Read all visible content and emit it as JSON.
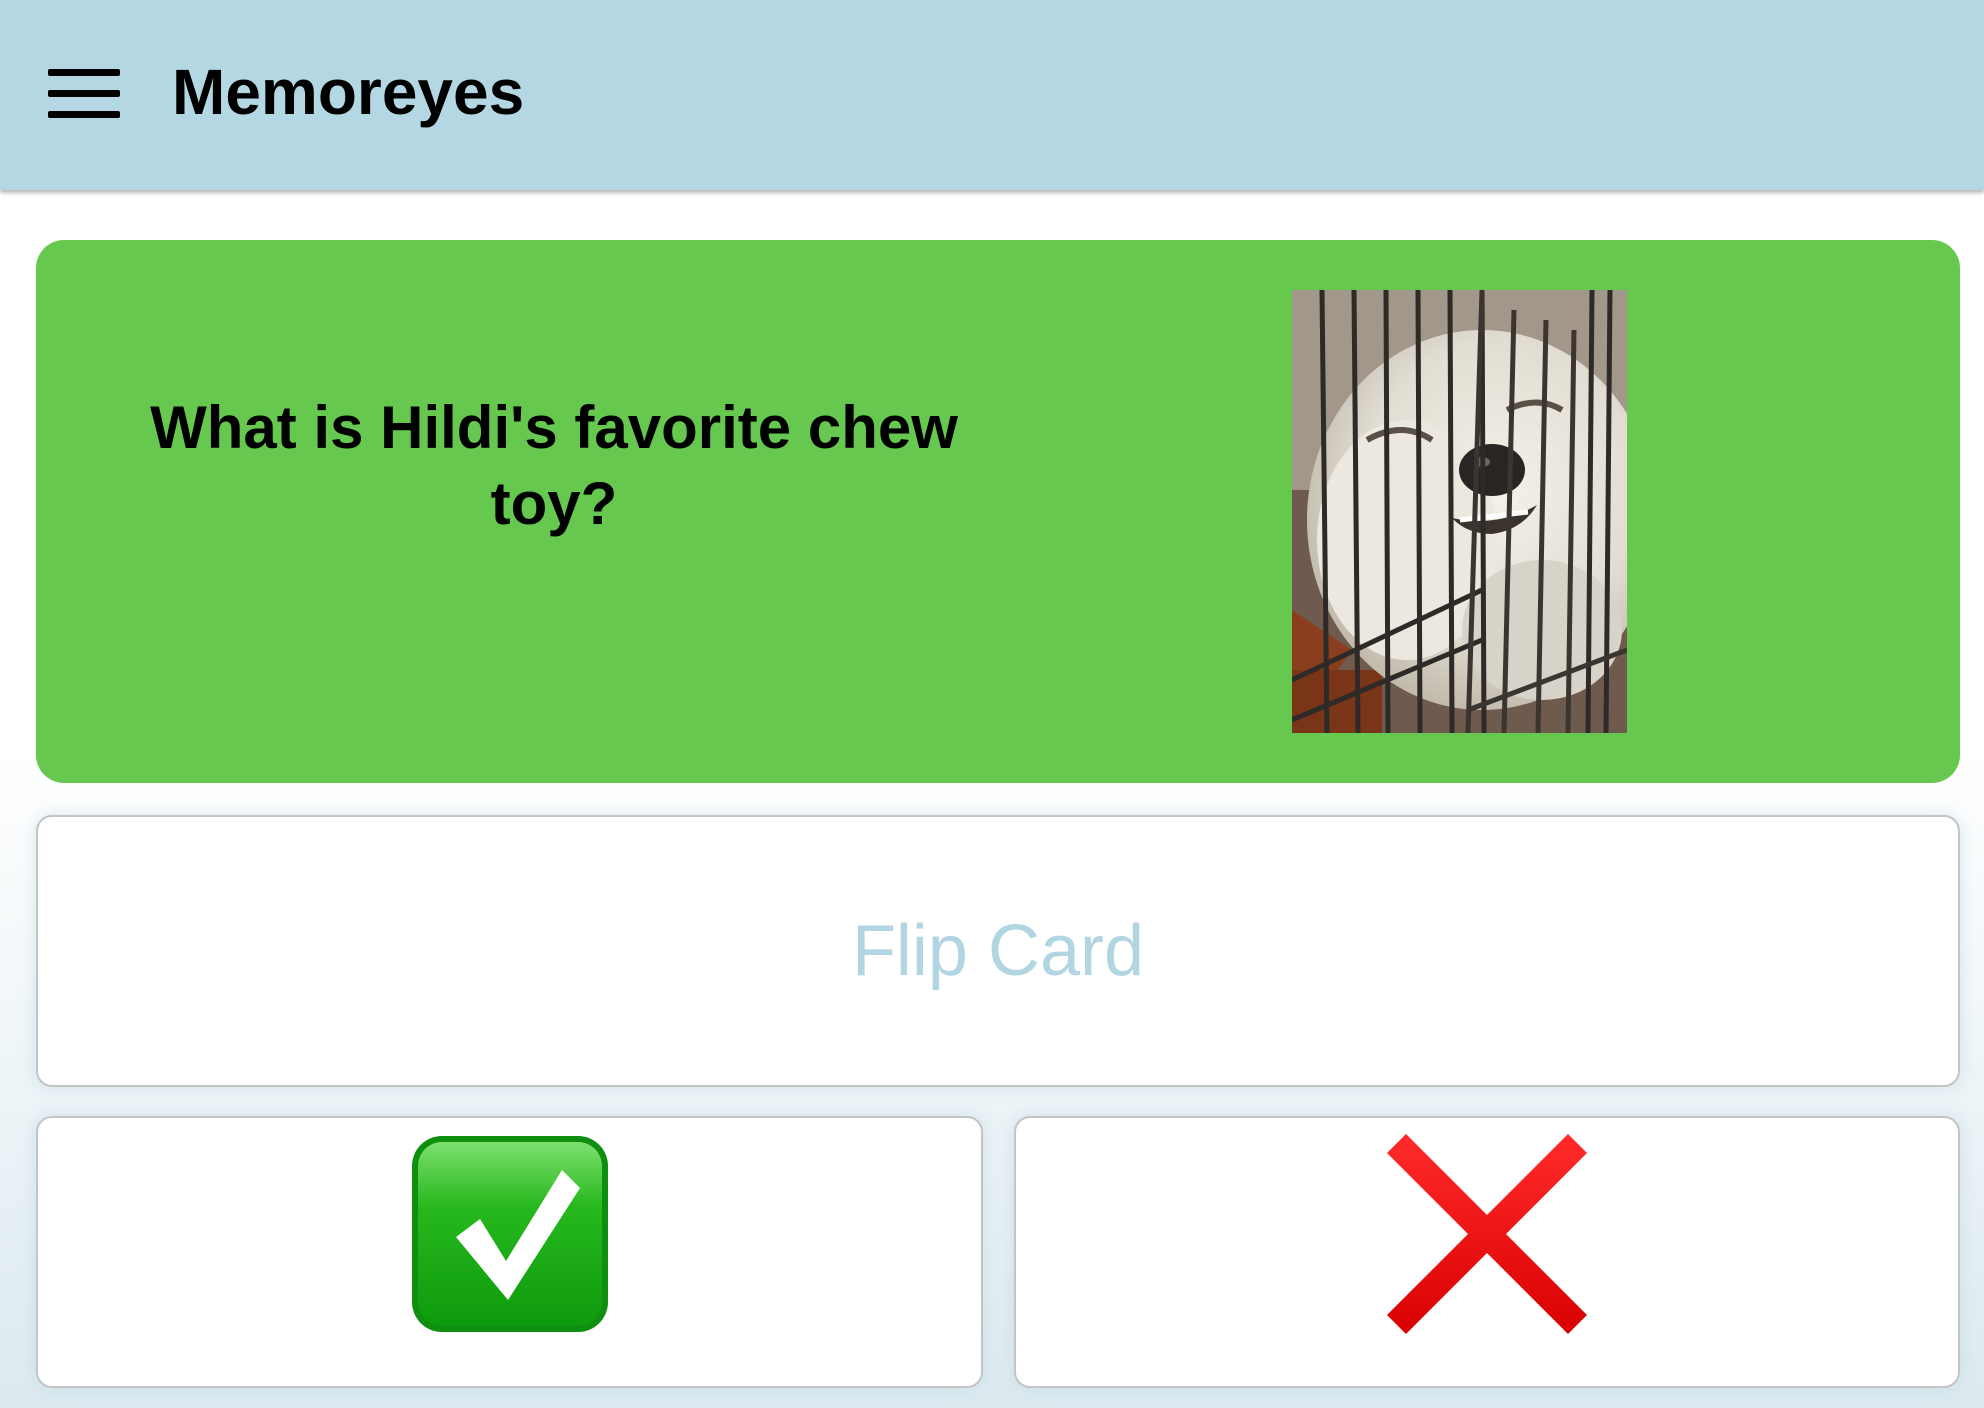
{
  "app": {
    "title": "Memoreyes",
    "menu_icon": "hamburger-menu-icon"
  },
  "card": {
    "question": "What is Hildi's favorite chew toy?",
    "background_color": "#66c84f",
    "image": {
      "subject": "white dog pressing face against wire crate bars"
    }
  },
  "actions": {
    "flip_label": "Flip Card",
    "correct_icon": "check-mark-icon",
    "incorrect_icon": "cross-mark-icon"
  },
  "colors": {
    "app_bar": "#b4d8e3",
    "flip_text": "#b1d5e1",
    "check": "#1fb41a",
    "cross": "#e5000c"
  }
}
